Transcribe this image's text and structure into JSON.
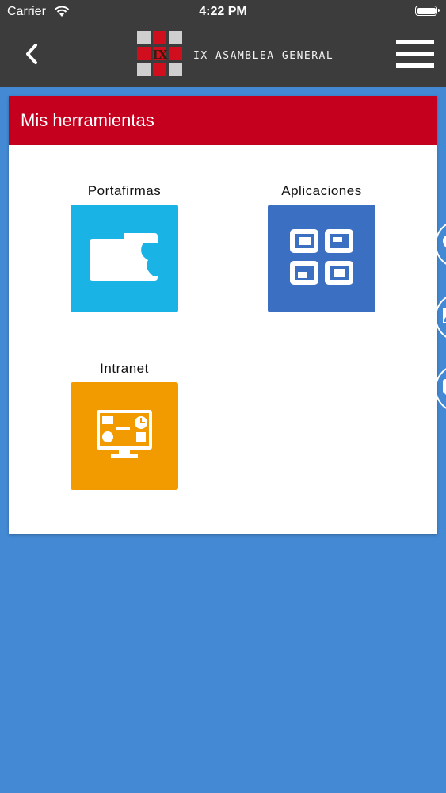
{
  "status_bar": {
    "carrier": "Carrier",
    "time": "4:22 PM"
  },
  "nav": {
    "title": "IX ASAMBLEA GENERAL",
    "logo_mark": "IX",
    "back_icon": "chevron-left-icon",
    "menu_icon": "hamburger-icon"
  },
  "panel": {
    "title": "Mis herramientas",
    "tools": [
      {
        "label": "Portafirmas",
        "color": "#1ab3e6",
        "icon": "folder-icon"
      },
      {
        "label": "Aplicaciones",
        "color": "#3a6fc2",
        "icon": "apps-grid-icon"
      },
      {
        "label": "Intranet",
        "color": "#f29b00",
        "icon": "monitor-icon"
      }
    ]
  },
  "colors": {
    "accent": "#c5001f",
    "background": "#4389d3",
    "topbar": "#3c3c3c"
  },
  "side_tabs": [
    "location-icon",
    "image-icon",
    "chat-icon"
  ]
}
